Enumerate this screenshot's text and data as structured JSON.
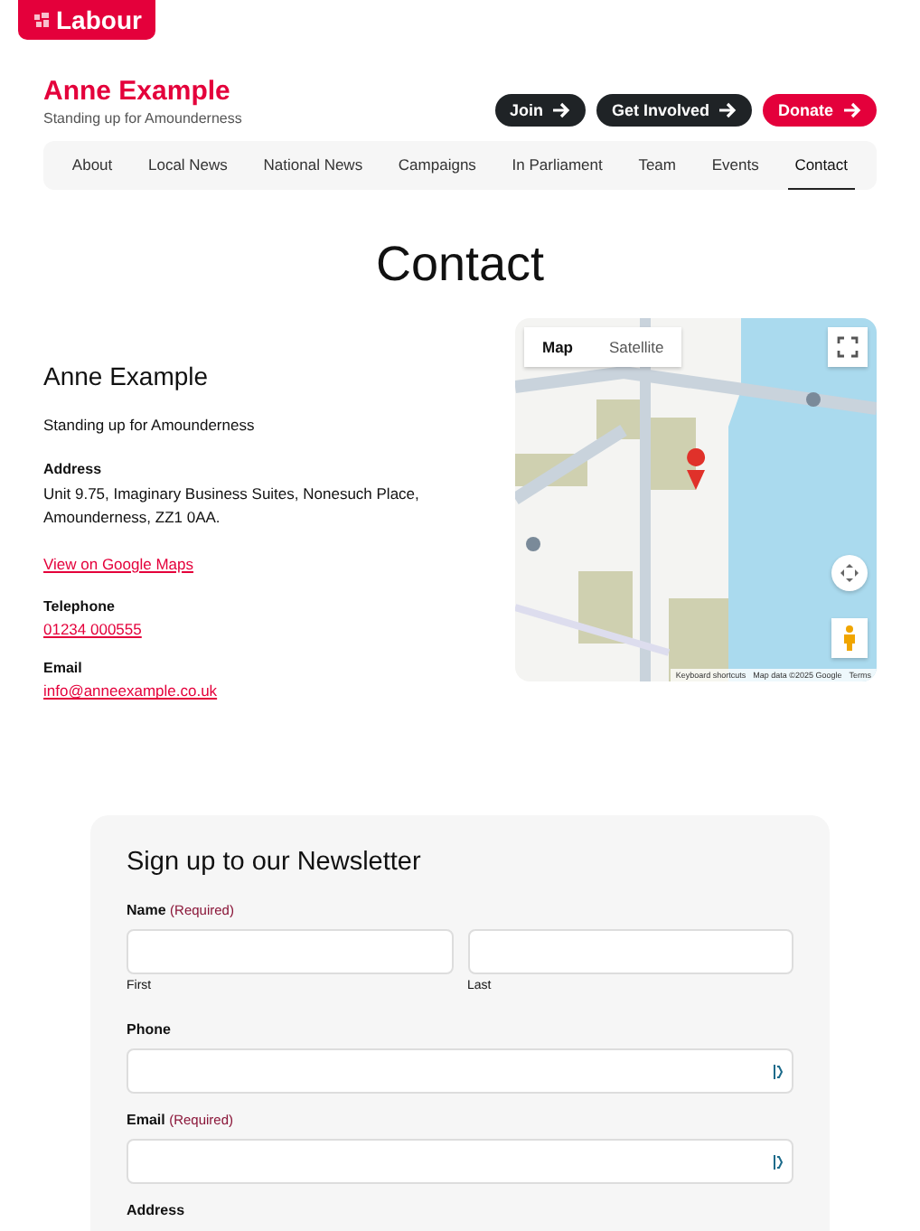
{
  "logo": {
    "text": "Labour"
  },
  "header": {
    "name": "Anne Example",
    "tagline": "Standing up for Amounderness"
  },
  "actions": [
    {
      "label": "Join",
      "kind": "dark"
    },
    {
      "label": "Get Involved",
      "kind": "dark"
    },
    {
      "label": "Donate",
      "kind": "accent"
    }
  ],
  "nav": [
    {
      "label": "About",
      "selected": false
    },
    {
      "label": "Local News",
      "selected": false
    },
    {
      "label": "National News",
      "selected": false
    },
    {
      "label": "Campaigns",
      "selected": false
    },
    {
      "label": "In Parliament",
      "selected": false
    },
    {
      "label": "Team",
      "selected": false
    },
    {
      "label": "Events",
      "selected": false
    },
    {
      "label": "Contact",
      "selected": true
    }
  ],
  "page_title": "Contact",
  "contact": {
    "name": "Anne Example",
    "tagline": "Standing up for Amounderness",
    "address_label": "Address",
    "address": "Unit 9.75, Imaginary Business Suites, Nonesuch Place, Amounderness, ZZ1 0AA.",
    "map_link": "View on Google Maps",
    "phone_label": "Telephone",
    "phone": "01234 000555",
    "email_label": "Email",
    "email": "info@anneexample.co.uk"
  },
  "map": {
    "kind": "picture",
    "modes": [
      {
        "label": "Map",
        "selected": true
      },
      {
        "label": "Satellite",
        "selected": false
      }
    ],
    "attribution": [
      "Keyboard shortcuts",
      "Map data ©2025 Google",
      "Terms"
    ]
  },
  "newsletter": {
    "title": "Sign up to our Newsletter",
    "fields": [
      {
        "label": "Name",
        "required": "(Required)",
        "kind": "name",
        "sublabels": [
          "First",
          "Last"
        ]
      },
      {
        "label": "Phone",
        "kind": "text",
        "autofill": true
      },
      {
        "label": "Email",
        "required": "(Required)",
        "kind": "text",
        "autofill": true
      },
      {
        "label": "Address",
        "kind": "heading"
      }
    ]
  }
}
